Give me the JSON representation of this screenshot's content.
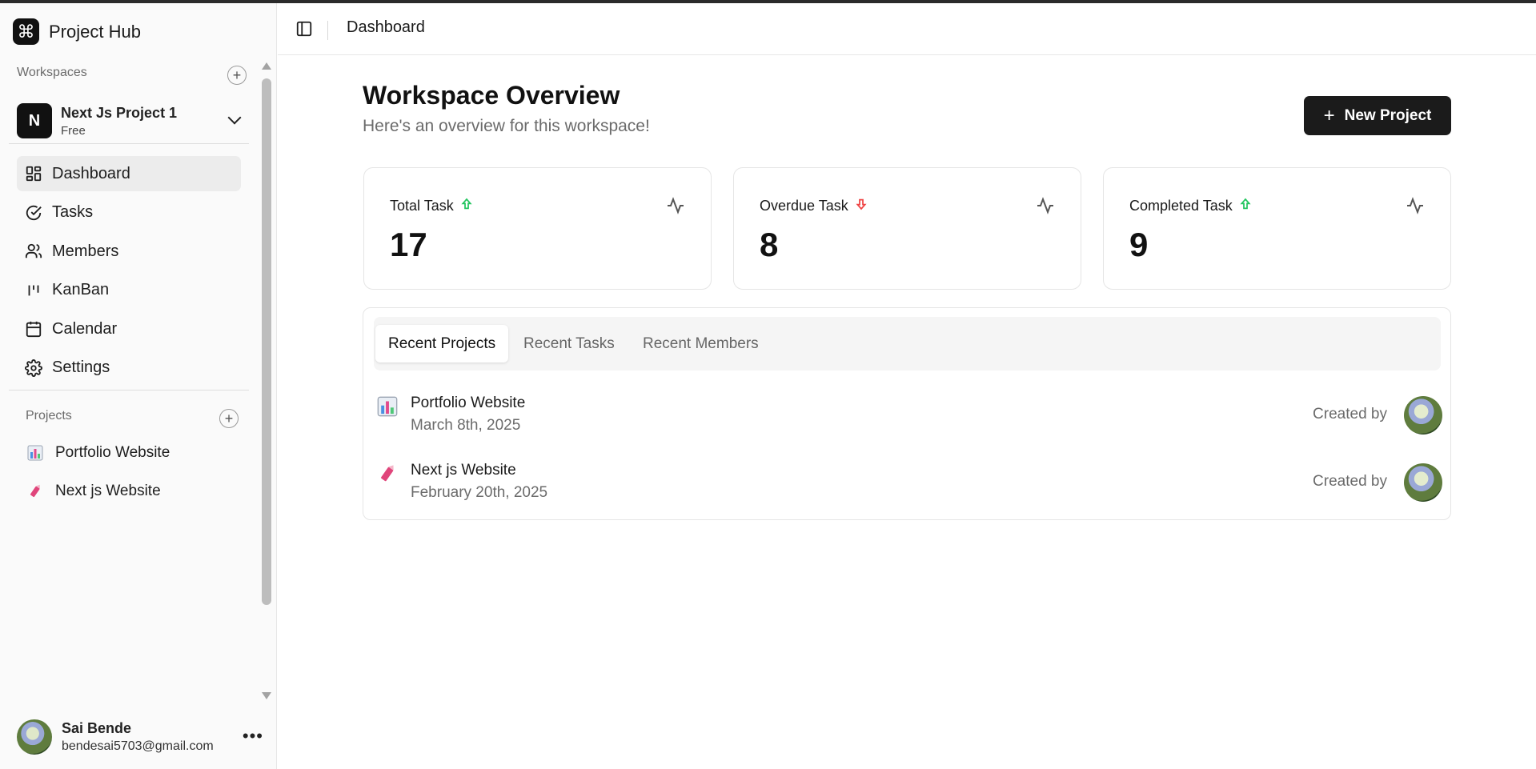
{
  "brand": {
    "name": "Project Hub",
    "logo_glyph": "⌘"
  },
  "sidebar": {
    "workspaces_label": "Workspaces",
    "workspace": {
      "initial": "N",
      "name": "Next Js Project 1",
      "plan": "Free"
    },
    "nav": [
      {
        "label": "Dashboard",
        "icon": "dashboard-icon",
        "active": true
      },
      {
        "label": "Tasks",
        "icon": "check-circle-icon"
      },
      {
        "label": "Members",
        "icon": "users-icon"
      },
      {
        "label": "KanBan",
        "icon": "kanban-icon"
      },
      {
        "label": "Calendar",
        "icon": "calendar-icon"
      },
      {
        "label": "Settings",
        "icon": "gear-icon"
      }
    ],
    "projects_label": "Projects",
    "projects": [
      {
        "emoji": "bar-chart-icon",
        "label": "Portfolio Website"
      },
      {
        "emoji": "crayon-icon",
        "label": "Next js Website"
      }
    ],
    "user": {
      "name": "Sai Bende",
      "email": "bendesai5703@gmail.com"
    }
  },
  "header": {
    "breadcrumb": "Dashboard"
  },
  "main": {
    "title": "Workspace Overview",
    "subtitle": "Here's an overview for this workspace!",
    "new_project_label": "New Project",
    "stats": [
      {
        "label": "Total Task",
        "value": "17",
        "trend": "up",
        "trend_color": "#22c55e"
      },
      {
        "label": "Overdue Task",
        "value": "8",
        "trend": "down",
        "trend_color": "#ef4444"
      },
      {
        "label": "Completed Task",
        "value": "9",
        "trend": "up",
        "trend_color": "#22c55e"
      }
    ],
    "tabs": [
      {
        "label": "Recent Projects",
        "active": true
      },
      {
        "label": "Recent Tasks"
      },
      {
        "label": "Recent Members"
      }
    ],
    "recent_projects": [
      {
        "name": "Portfolio Website",
        "date": "March 8th, 2025",
        "created_by_label": "Created by",
        "icon": "bar-chart-icon"
      },
      {
        "name": "Next js Website",
        "date": "February 20th, 2025",
        "created_by_label": "Created by",
        "icon": "crayon-icon"
      }
    ]
  }
}
